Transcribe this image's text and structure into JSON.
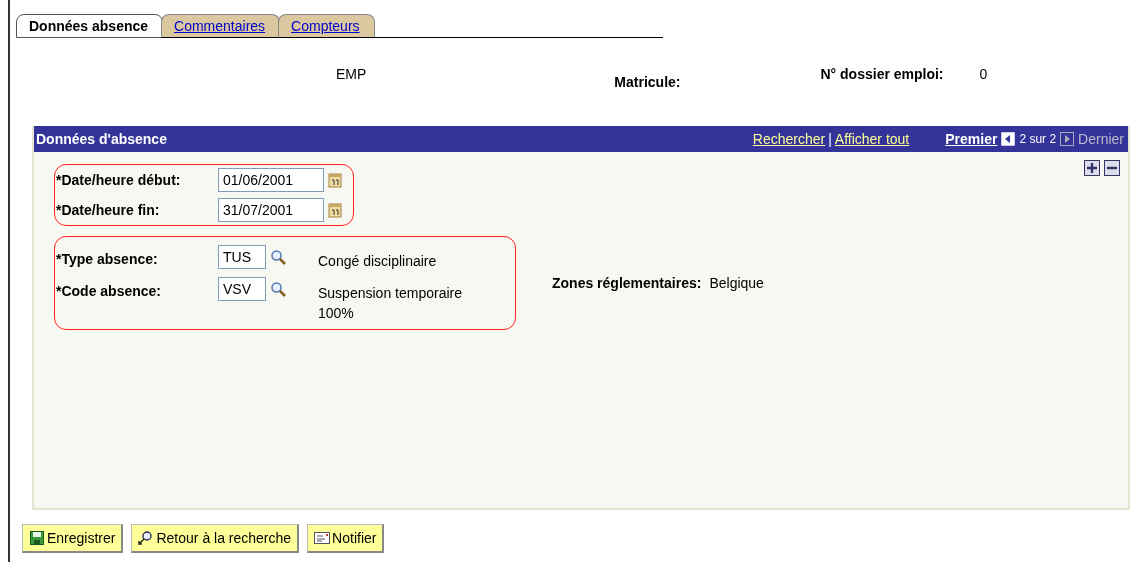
{
  "tabs": [
    {
      "label": "Données absence",
      "selected": true
    },
    {
      "label": "Commentaires",
      "selected": false
    },
    {
      "label": "Compteurs",
      "selected": false
    }
  ],
  "header": {
    "employee_class": "EMP",
    "matricule_label": "Matricule:",
    "job_label": "N° dossier emploi:",
    "job_value": "0"
  },
  "panel": {
    "title": "Données d'absence",
    "links": [
      "Rechercher",
      "Afficher tout"
    ],
    "separator": "|",
    "first": "Premier",
    "count": "2 sur 2",
    "last": "Dernier",
    "date_fields": [
      {
        "label": "*Date/heure début:",
        "value": "01/06/2001"
      },
      {
        "label": "*Date/heure fin:",
        "value": "31/07/2001"
      }
    ],
    "code_fields": [
      {
        "label": "*Type absence:",
        "value": "TUS",
        "description": "Congé disciplinaire"
      },
      {
        "label": "*Code absence:",
        "value": "VSV",
        "description": "Suspension temporaire 100%"
      }
    ],
    "zones_label": "Zones réglementaires:",
    "zones_value": "Belgique"
  },
  "buttons": [
    {
      "label": "Enregistrer",
      "kind": "save"
    },
    {
      "label": "Retour à la recherche",
      "kind": "search"
    },
    {
      "label": "Notifier",
      "kind": "notify"
    }
  ]
}
